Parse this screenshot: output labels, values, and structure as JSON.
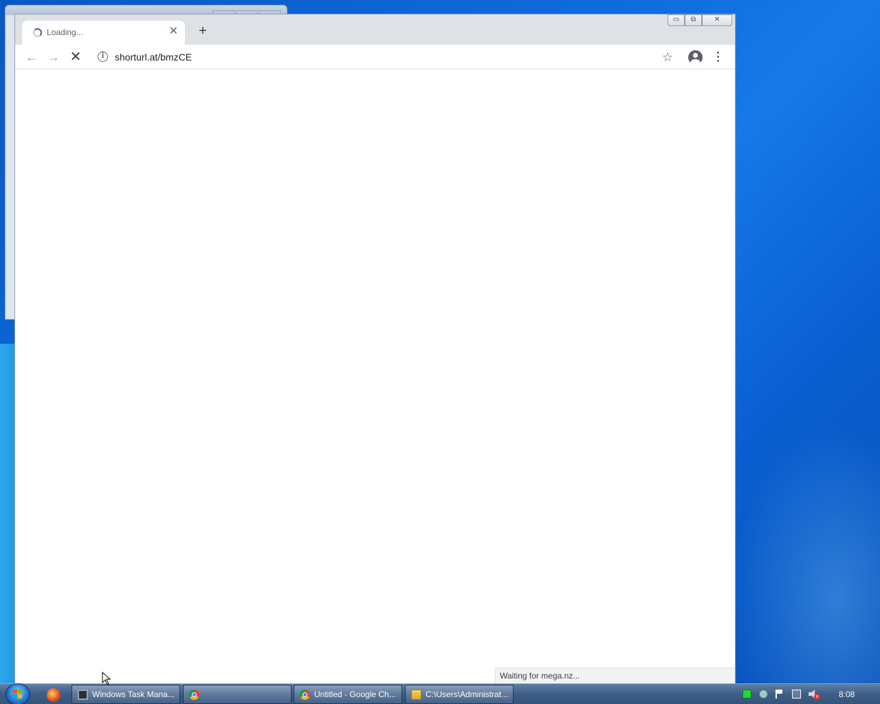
{
  "colors": {
    "desktop": "#0d6ad8",
    "tab_strip": "#dee1e6",
    "taskbar": "#3e5e86",
    "tray_green": "#28d33a"
  },
  "browser": {
    "tab": {
      "title": "Loading...",
      "close_icon": "close-icon",
      "status": "loading-spinner-icon"
    },
    "new_tab_label": "+",
    "window_controls": {
      "minimize": "▭",
      "maximize": "⧉",
      "close": "✕"
    },
    "toolbar": {
      "back_icon": "←",
      "forward_icon": "→",
      "stop_icon": "✕",
      "info_icon": "i",
      "url": "shorturl.at/bmzCE",
      "bookmark_icon": "☆"
    },
    "status_text": "Waiting for mega.nz..."
  },
  "taskbar": {
    "buttons": [
      {
        "label": "Windows Task Mana...",
        "icon": "task-manager-icon"
      },
      {
        "label": "",
        "icon": "chrome-icon"
      },
      {
        "label": "Untitled - Google Ch...",
        "icon": "chrome-icon"
      },
      {
        "label": "C:\\Users\\Administrat...",
        "icon": "folder-icon"
      }
    ],
    "quick_launch": [
      "firefox-icon"
    ],
    "tray_icons": [
      "status-green-icon",
      "security-icon",
      "action-center-flag-icon",
      "network-icon",
      "volume-muted-icon"
    ],
    "clock": "8:08"
  }
}
